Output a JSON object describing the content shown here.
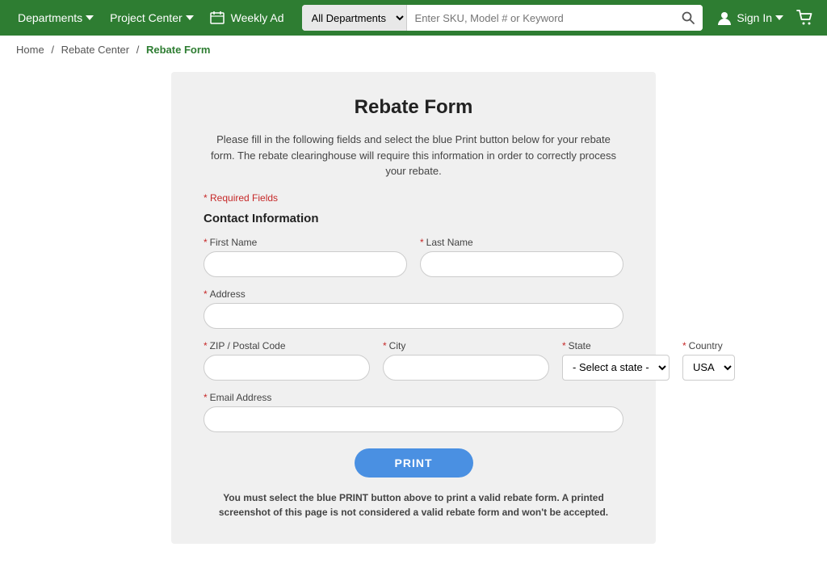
{
  "header": {
    "bg_color": "#2e7d32",
    "departments_label": "Departments",
    "project_center_label": "Project Center",
    "weekly_ad_label": "Weekly Ad",
    "search": {
      "dept_option": "All Departments",
      "placeholder": "Enter SKU, Model # or Keyword"
    },
    "signin_label": "Sign In",
    "cart_label": ""
  },
  "breadcrumb": {
    "home": "Home",
    "rebate_center": "Rebate Center",
    "current": "Rebate Form"
  },
  "form": {
    "title": "Rebate Form",
    "description": "Please fill in the following fields and select the blue Print button below for your rebate form. The rebate clearinghouse will require this information in order to correctly process your rebate.",
    "required_note": "* Required Fields",
    "section_title": "Contact Information",
    "fields": {
      "first_name_label": "First Name",
      "last_name_label": "Last Name",
      "address_label": "Address",
      "zip_label": "ZIP / Postal Code",
      "city_label": "City",
      "state_label": "State",
      "state_placeholder": "- Select a state -",
      "country_label": "Country",
      "country_value": "USA",
      "email_label": "Email Address"
    },
    "print_button": "PRINT",
    "print_note": "You must select the blue PRINT button above to print a valid rebate form. A printed screenshot of this page is not considered a valid rebate form and won't be accepted."
  }
}
